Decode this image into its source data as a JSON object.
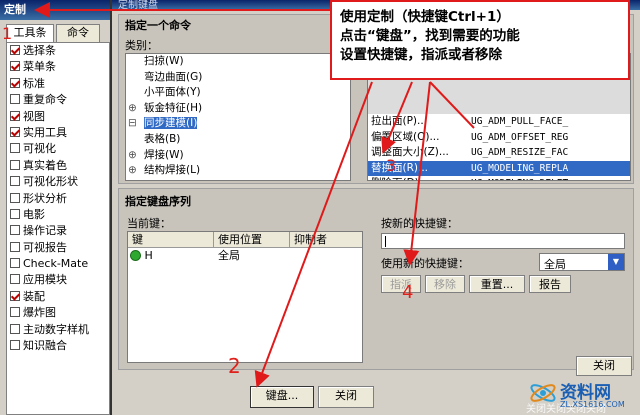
{
  "outer": {
    "title": "定制",
    "tabs": [
      "工具条",
      "命令"
    ],
    "toolbars": [
      {
        "label": "选择条",
        "checked": true
      },
      {
        "label": "菜单条",
        "checked": true
      },
      {
        "label": "标准",
        "checked": true
      },
      {
        "label": "重复命令",
        "checked": false
      },
      {
        "label": "视图",
        "checked": true
      },
      {
        "label": "实用工具",
        "checked": true
      },
      {
        "label": "可视化",
        "checked": false
      },
      {
        "label": "真实着色",
        "checked": false
      },
      {
        "label": "可视化形状",
        "checked": false
      },
      {
        "label": "形状分析",
        "checked": false
      },
      {
        "label": "电影",
        "checked": false
      },
      {
        "label": "操作记录",
        "checked": false
      },
      {
        "label": "可视报告",
        "checked": false
      },
      {
        "label": "Check-Mate",
        "checked": false
      },
      {
        "label": "应用模块",
        "checked": false
      },
      {
        "label": "装配",
        "checked": true
      },
      {
        "label": "爆炸图",
        "checked": false
      },
      {
        "label": "主动数字样机",
        "checked": false
      },
      {
        "label": "知识融合",
        "checked": false
      }
    ],
    "close_button": "关闭"
  },
  "dialog": {
    "title": "定制键盘",
    "command_section": "指定一个命令",
    "category_label": "类别：",
    "categories": [
      {
        "label": "扫掠(W)",
        "expander": ""
      },
      {
        "label": "弯边曲面(G)",
        "expander": ""
      },
      {
        "label": "小平面体(Y)",
        "expander": ""
      },
      {
        "label": "钣金特征(H)",
        "expander": "⊕"
      },
      {
        "label": "同步建模(I)",
        "expander": "⊟",
        "selected": true
      },
      {
        "label": "表格(B)",
        "expander": ""
      },
      {
        "label": "焊接(W)",
        "expander": "⊕"
      },
      {
        "label": "结构焊接(L)",
        "expander": "⊕"
      }
    ],
    "commands": [
      {
        "label": "拉出面(P)...",
        "id": "UG_ADM_PULL_FACE_"
      },
      {
        "label": "偏置区域(O)...",
        "id": "UG_ADM_OFFSET_REG"
      },
      {
        "label": "调整面大小(Z)...",
        "id": "UG_ADM_RESIZE_FAC"
      },
      {
        "label": "替换面(R)...",
        "id": "UG_MODELING_REPLA",
        "selected": true
      },
      {
        "label": "删除面(D)...",
        "id": "UG_MODELING_DELET"
      }
    ],
    "key_section": "指定键盘序列",
    "current_keys_label": "当前键：",
    "key_table_headers": [
      "键",
      "使用位置",
      "抑制者"
    ],
    "key_rows": [
      {
        "key": "H",
        "location": "全局",
        "suppressed_by": ""
      }
    ],
    "new_shortcut_label": "按新的快捷键：",
    "new_shortcut_value": "",
    "use_shortcut_label": "使用新的快捷键：",
    "scope_value": "全局",
    "assign_button": "指派",
    "remove_button": "移除",
    "reset_button": "重置...",
    "report_button": "报告",
    "close_button": "关闭",
    "keyboard_button": "键盘...",
    "bottom_close_button": "关闭"
  },
  "callout": {
    "line1": "使用定制（快捷键Ctrl+1）",
    "line2": "点击“键盘”，找到需要的功能",
    "line3": "设置快捷键，指派或者移除"
  },
  "markers": [
    "1",
    "2",
    "3",
    "4"
  ],
  "watermark": {
    "text": "资料网",
    "url": "ZL.XS1616.COM",
    "partial": "关闭关闭关闭关闭"
  },
  "colors": {
    "annotation": "#e01a1a",
    "selection": "#316ac5"
  }
}
